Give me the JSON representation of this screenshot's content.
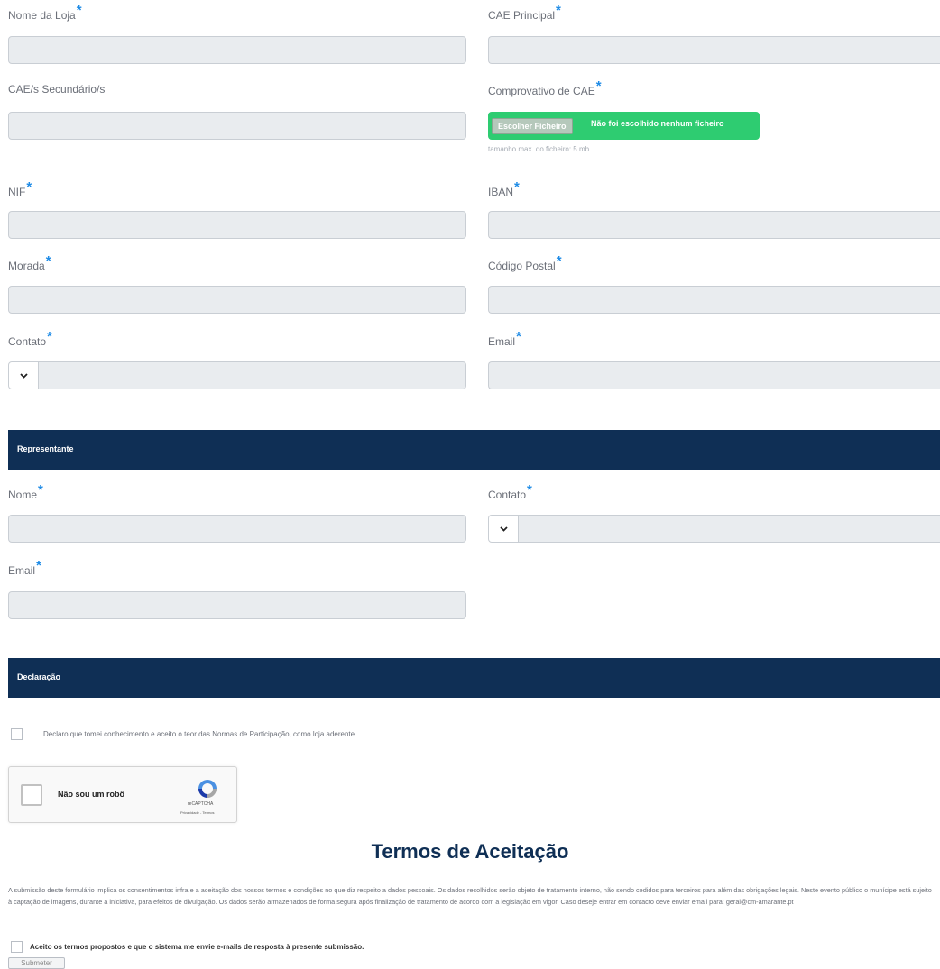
{
  "fields": {
    "nome_loja": {
      "label": "Nome da Loja",
      "required": "*"
    },
    "cae_principal": {
      "label": "CAE Principal",
      "required": "*"
    },
    "cae_secundario": {
      "label": "CAE/s Secundário/s"
    },
    "comprovativo_cae": {
      "label": "Comprovativo de CAE",
      "required": "*",
      "choose_button": "Escolher Ficheiro",
      "no_file": "Não foi escolhido nenhum ficheiro",
      "hint": "tamanho max. do ficheiro: 5 mb"
    },
    "nif": {
      "label": "NIF",
      "required": "*"
    },
    "iban": {
      "label": "IBAN",
      "required": "*"
    },
    "morada": {
      "label": "Morada",
      "required": "*"
    },
    "codigo_postal": {
      "label": "Código Postal",
      "required": "*"
    },
    "contato": {
      "label": "Contato",
      "required": "*"
    },
    "email": {
      "label": "Email",
      "required": "*"
    }
  },
  "representante": {
    "section_title": "Representante",
    "nome": {
      "label": "Nome",
      "required": "*"
    },
    "contato": {
      "label": "Contato",
      "required": "*"
    },
    "email": {
      "label": "Email",
      "required": "*"
    }
  },
  "declaracao": {
    "section_title": "Declaração",
    "checkbox_text": "Declaro que tomei conhecimento e aceito o teor das Normas de Participação, como loja aderente."
  },
  "captcha": {
    "label": "Não sou um robô",
    "brand": "reCAPTCHA",
    "links": "Privacidade - Termos"
  },
  "terms": {
    "title": "Termos de Aceitação",
    "body": "A submissão deste formulário implica os consentimentos infra e a aceitação dos nossos termos e condições no que diz respeito a dados pessoais. Os dados recolhidos serão objeto de tratamento interno, não sendo cedidos para terceiros para além das obrigações legais. Neste evento público o munícipe está sujeito à captação de imagens, durante a iniciativa, para efeitos de divulgação. Os dados serão armazenados de forma segura após finalização de tratamento de acordo com a legislação em vigor. Caso deseje entrar em contacto deve enviar email para: geral@cm-amarante.pt",
    "accept_text": "Aceito os termos propostos e que o sistema me envie e-mails de resposta à presente submissão.",
    "submit_label": "Submeter"
  },
  "colors": {
    "section_bar": "#0f2f55",
    "file_input": "#2ecc71",
    "required_star": "#1e8be6",
    "title": "#0f2f55"
  }
}
